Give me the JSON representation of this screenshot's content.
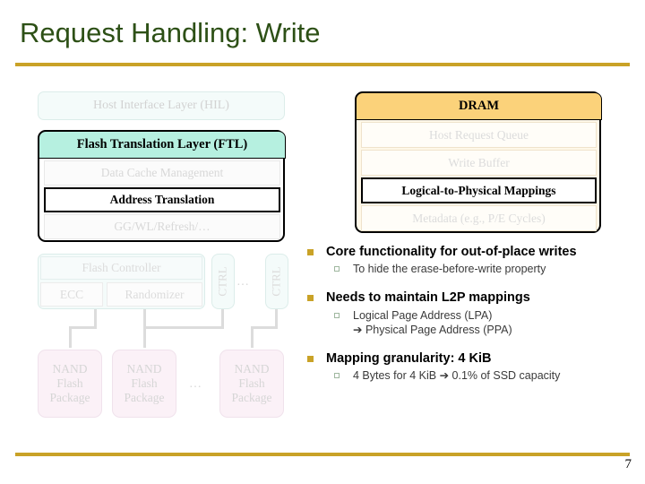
{
  "slide": {
    "title": "Request Handling: Write",
    "page_number": "7",
    "accent_color": "#c9a227",
    "title_color": "#2d5016"
  },
  "diagram": {
    "host_interface_layer": "Host Interface Layer (HIL)",
    "ftl": {
      "header": "Flash Translation Layer (FTL)",
      "rows": [
        "Data Cache Management",
        "Address Translation",
        "GG/WL/Refresh/…"
      ]
    },
    "dram": {
      "header": "DRAM",
      "rows": [
        "Host Request Queue",
        "Write Buffer",
        "Logical-to-Physical Mappings",
        "Metadata (e.g., P/E Cycles)"
      ]
    },
    "flash_controller": {
      "header": "Flash Controller",
      "ecc": "ECC",
      "randomizer": "Randomizer"
    },
    "ctrl_label": "CTRL",
    "ellipsis": "…",
    "nand_package": "NAND\nFlash\nPackage",
    "nand_line1": "NAND",
    "nand_line2": "Flash",
    "nand_line3": "Package"
  },
  "bullets": [
    {
      "level1": "Core functionality for out-of-place writes",
      "level2": [
        "To hide the erase-before-write property"
      ]
    },
    {
      "level1": "Needs to maintain L2P mappings",
      "level2": [
        "Logical Page Address (LPA)"
      ],
      "continuation": "➔ Physical Page Address (PPA)"
    },
    {
      "level1": "Mapping granularity: 4 KiB",
      "level2": [
        "4 Bytes for 4 KiB ➔ 0.1% of SSD capacity"
      ]
    }
  ]
}
